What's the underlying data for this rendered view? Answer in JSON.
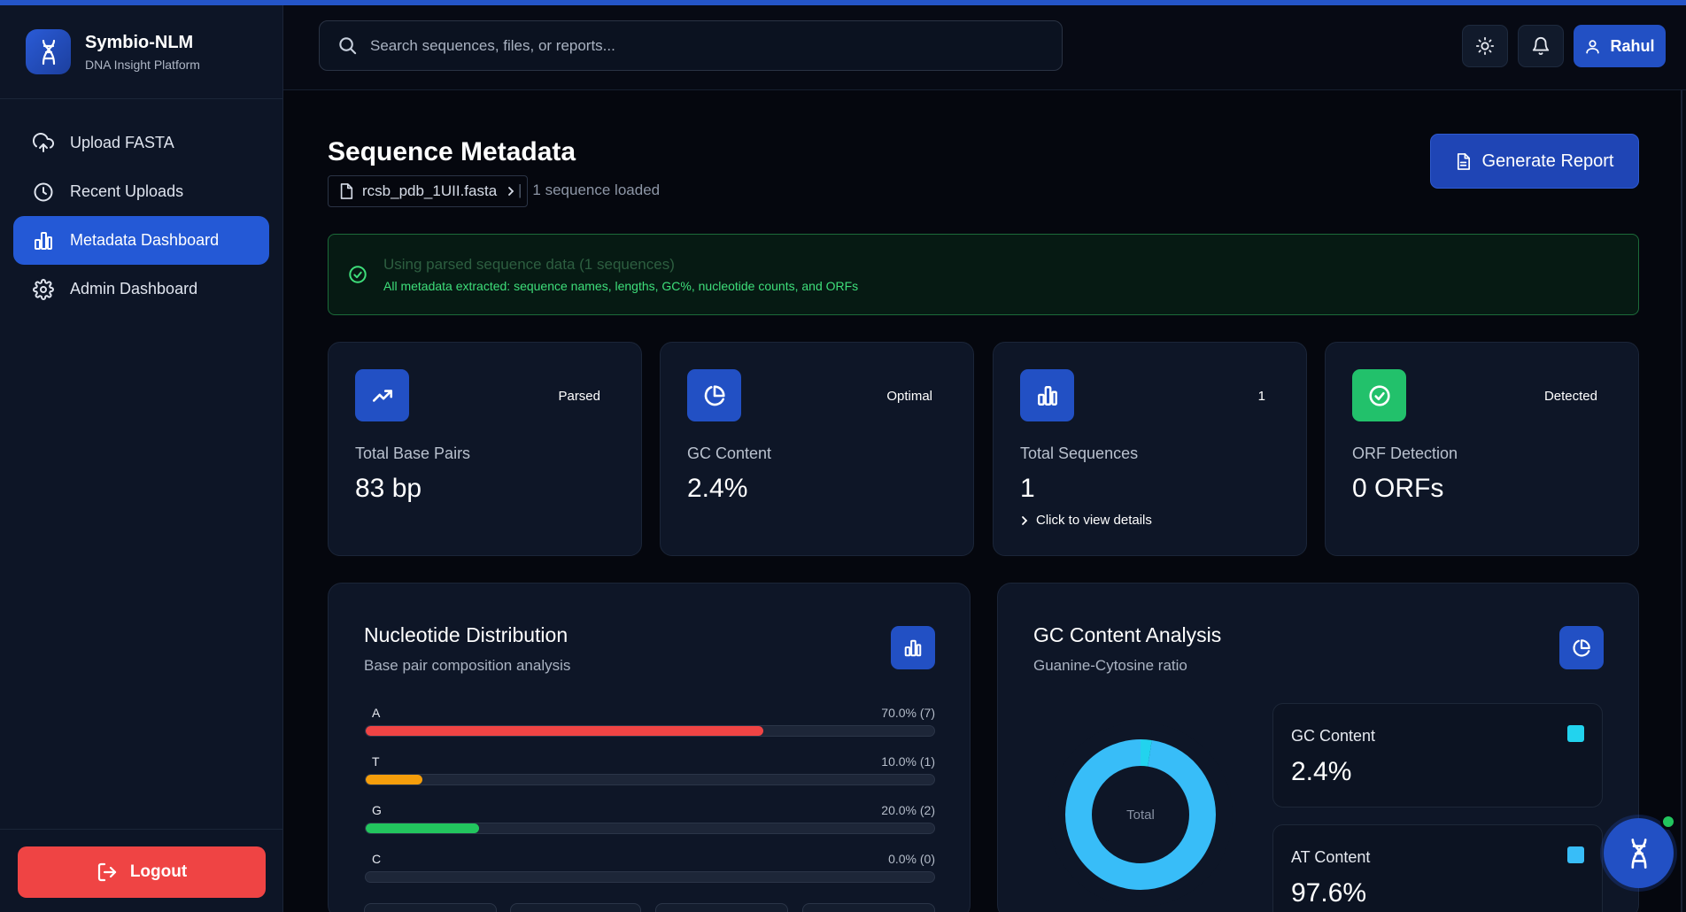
{
  "brand": {
    "title": "Symbio-NLM",
    "subtitle": "DNA Insight Platform"
  },
  "nav": {
    "items": [
      {
        "label": "Upload FASTA",
        "icon": "upload-cloud-icon"
      },
      {
        "label": "Recent Uploads",
        "icon": "clock-icon"
      },
      {
        "label": "Metadata Dashboard",
        "icon": "bar-chart-icon",
        "active": true
      },
      {
        "label": "Admin Dashboard",
        "icon": "gear-icon"
      }
    ]
  },
  "sidebar": {
    "logout_label": "Logout"
  },
  "search": {
    "placeholder": "Search sequences, files, or reports..."
  },
  "header": {
    "user_label": "Rahul"
  },
  "page": {
    "title": "Sequence Metadata",
    "file_name": "rcsb_pdb_1UII.fasta",
    "separator": "|",
    "sequence_status": "1 sequence loaded",
    "generate_label": "Generate Report"
  },
  "alert": {
    "title": "Using parsed sequence data (1 sequences)",
    "message": "All metadata extracted: sequence names, lengths, GC%, nucleotide counts, and ORFs"
  },
  "stats": [
    {
      "badge": "Parsed",
      "label": "Total Base Pairs",
      "value": "83 bp",
      "icon": "trending-up-icon",
      "color": "#2250c4"
    },
    {
      "badge": "Optimal",
      "label": "GC Content",
      "value": "2.4%",
      "icon": "pie-chart-icon",
      "color": "#2250c4"
    },
    {
      "badge": "1",
      "label": "Total Sequences",
      "value": "1",
      "link": "Click to view details",
      "icon": "bar-chart-icon",
      "color": "#2250c4"
    },
    {
      "badge": "Detected",
      "label": "ORF Detection",
      "value": "0 ORFs",
      "icon": "check-circle-icon",
      "color": "#22c16b"
    }
  ],
  "nucleotide": {
    "title": "Nucleotide Distribution",
    "subtitle": "Base pair composition analysis",
    "bases": [
      {
        "base": "A",
        "pct_text": "70.0% (7)",
        "fraction": 0.7,
        "color": "#ef4444"
      },
      {
        "base": "T",
        "pct_text": "10.0% (1)",
        "fraction": 0.1,
        "color": "#f59e0b"
      },
      {
        "base": "G",
        "pct_text": "20.0% (2)",
        "fraction": 0.2,
        "color": "#22c55e"
      },
      {
        "base": "C",
        "pct_text": "0.0% (0)",
        "fraction": 0.0,
        "color": "#3b82f6"
      }
    ]
  },
  "gc_analysis": {
    "title": "GC Content Analysis",
    "subtitle": "Guanine-Cytosine ratio",
    "donut_center": "Total",
    "gc_fraction": 0.024,
    "gc_color": "#22d3ee",
    "at_color": "#38bdf8",
    "cards": [
      {
        "label": "GC Content",
        "value": "2.4%",
        "color": "#22d3ee"
      },
      {
        "label": "AT Content",
        "value": "97.6%",
        "color": "#38bdf8"
      }
    ]
  }
}
